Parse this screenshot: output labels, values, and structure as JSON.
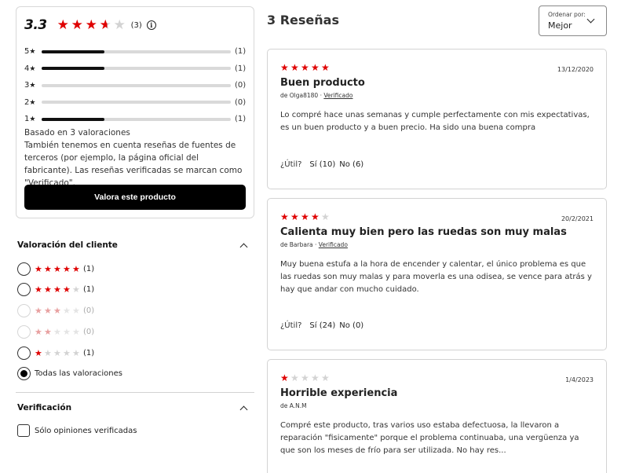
{
  "summary": {
    "average": "3.3",
    "rating": 3.3,
    "count": "(3)",
    "info_icon": "i",
    "bars": [
      {
        "label": "5",
        "count": "(1)",
        "fraction": 0.333
      },
      {
        "label": "4",
        "count": "(1)",
        "fraction": 0.333
      },
      {
        "label": "3",
        "count": "(0)",
        "fraction": 0
      },
      {
        "label": "2",
        "count": "(0)",
        "fraction": 0
      },
      {
        "label": "1",
        "count": "(1)",
        "fraction": 0.333
      }
    ],
    "based_on": "Basado en 3 valoraciones",
    "third_party_note": "También tenemos en cuenta reseñas de fuentes de terceros (por ejemplo, la página oficial del fabricante). Las reseñas verificadas se marcan como \"Verificado\".",
    "rate_button": "Valora este producto"
  },
  "filters": {
    "rating_title": "Valoración del cliente",
    "rating_options": [
      {
        "stars": 5,
        "count": "(1)",
        "enabled": true
      },
      {
        "stars": 4,
        "count": "(1)",
        "enabled": true
      },
      {
        "stars": 3,
        "count": "(0)",
        "enabled": false
      },
      {
        "stars": 2,
        "count": "(0)",
        "enabled": false
      },
      {
        "stars": 1,
        "count": "(1)",
        "enabled": true
      }
    ],
    "all_label": "Todas las valoraciones",
    "verification_title": "Verificación",
    "verified_only_label": "Sólo opiniones verificadas"
  },
  "reviews_header": {
    "title": "3 Reseñas",
    "sort_label": "Ordenar por:",
    "sort_value": "Mejor"
  },
  "reviews": [
    {
      "stars": 5,
      "date": "13/12/2020",
      "title": "Buen producto",
      "author": "de Olga8180 · ",
      "verified": "Verificado",
      "text": "Lo compré hace unas semanas y cumple perfectamente con mis expectativas, es un buen producto y a buen precio. Ha sido una buena compra",
      "useful_label": "¿Útil?",
      "yes": "Sí (10)",
      "no": "No (6)"
    },
    {
      "stars": 4,
      "date": "20/2/2021",
      "title": "Calienta muy bien pero las ruedas son muy malas",
      "author": "de Barbara · ",
      "verified": "Verificado",
      "text": "Muy buena estufa a la hora de encender y calentar, el único problema es que las ruedas son muy malas y para moverla es una odisea, se vence para atrás y hay que andar con mucho cuidado.",
      "useful_label": "¿Útil?",
      "yes": "Sí (24)",
      "no": "No (0)"
    },
    {
      "stars": 1,
      "date": "1/4/2023",
      "title": "Horrible experiencia",
      "author": "de A.N.M",
      "verified": "",
      "text": "Compré este producto, tras varios uso estaba defectuosa, la llevaron a reparación \"fisicamente\" porque el problema continuaba, una vergüenza ya que son los meses de frío para ser utilizada. No hay res...",
      "useful_label": "",
      "yes": "",
      "no": ""
    }
  ],
  "colors": {
    "star_on": "#df0000",
    "star_off": "#d3d3d3",
    "button_bg": "#000000"
  }
}
